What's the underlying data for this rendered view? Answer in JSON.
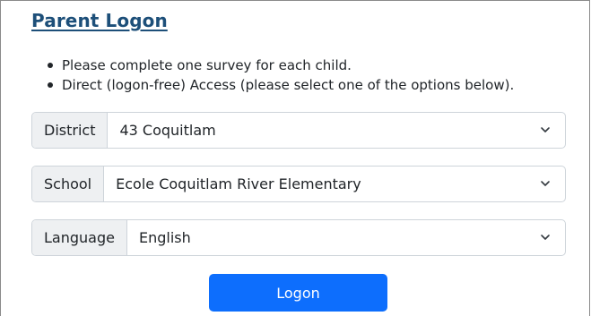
{
  "title": "Parent Logon",
  "bullets": [
    "Please complete one survey for each child.",
    "Direct (logon-free) Access (please select one of the options below)."
  ],
  "fields": {
    "district": {
      "label": "District",
      "value": "43 Coquitlam"
    },
    "school": {
      "label": "School",
      "value": "Ecole Coquitlam River Elementary"
    },
    "language": {
      "label": "Language",
      "value": "English"
    }
  },
  "logon_button": "Logon",
  "colors": {
    "title": "#1d4f79",
    "button": "#0d6efd",
    "label_bg": "#eef0f2",
    "border": "#ced4da"
  },
  "icons": {
    "select_arrow": "chevron-down-icon"
  }
}
